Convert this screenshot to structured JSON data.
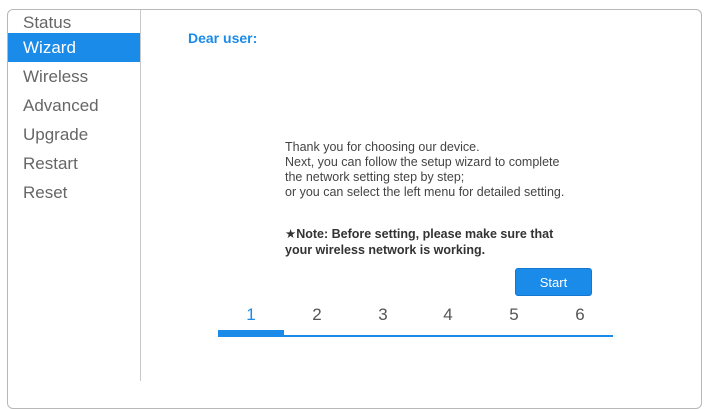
{
  "sidebar": {
    "items": [
      {
        "label": "Status"
      },
      {
        "label": "Wizard",
        "active": true
      },
      {
        "label": "Wireless"
      },
      {
        "label": "Advanced"
      },
      {
        "label": "Upgrade"
      },
      {
        "label": "Restart"
      },
      {
        "label": "Reset"
      }
    ]
  },
  "main": {
    "greeting": "Dear user:",
    "intro_lines": [
      "Thank you for choosing our device.",
      "Next, you can follow the setup wizard to complete",
      "the network setting step by step;",
      "or you can select the left menu for detailed setting."
    ],
    "note_lines": [
      "★Note: Before setting, please make sure that",
      "your wireless network is working."
    ],
    "start_label": "Start",
    "steps": [
      "1",
      "2",
      "3",
      "4",
      "5",
      "6"
    ],
    "current_step": 1
  },
  "colors": {
    "accent": "#1a8be8",
    "menu_text": "#666666",
    "body_text": "#444444"
  }
}
